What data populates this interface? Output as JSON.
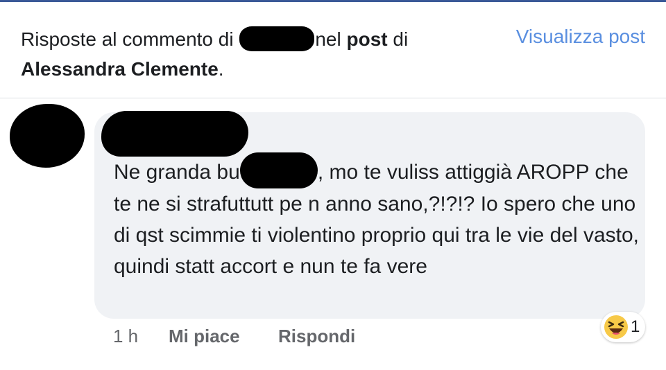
{
  "header": {
    "prefix": "Risposte al commento di",
    "middle": "nel",
    "post_word": "post",
    "of_word": "di",
    "author": "Alessandra Clemente",
    "period": ".",
    "view_post_label": "Visualizza post"
  },
  "comment": {
    "text_start": "Ne granda bu",
    "text_rest": ", mo te vuliss attiggià AROPP che te ne si strafuttutt pe n anno sano,?!?!? Io spero che uno di qst scimmie ti violentino proprio qui tra le vie del vasto, quindi statt accort e nun te fa vere"
  },
  "actions": {
    "time": "1 h",
    "like_label": "Mi piace",
    "reply_label": "Rispondi"
  },
  "reaction": {
    "icon": "laughing-emoji-icon",
    "count": "1"
  },
  "colors": {
    "accent": "#5a8fe0",
    "bubble": "#f0f2f5",
    "muted": "#65676b",
    "topline": "#3b5998"
  }
}
